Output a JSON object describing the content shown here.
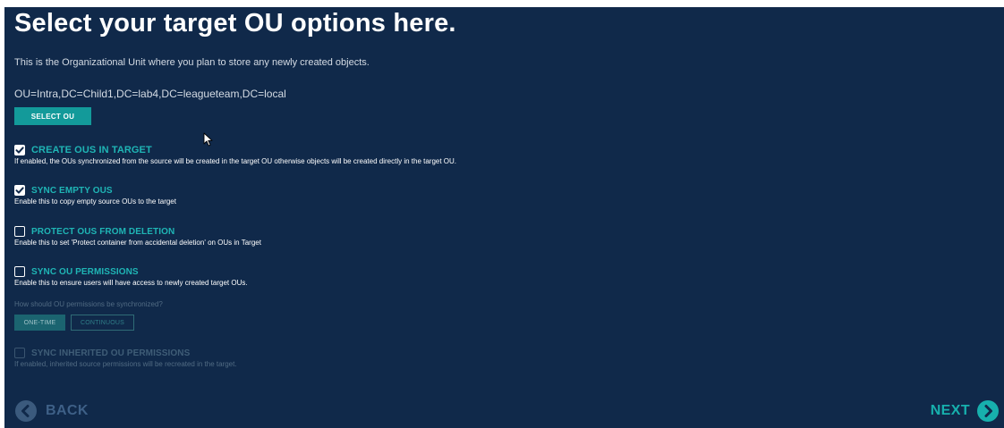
{
  "page": {
    "title": "Select your target OU options here.",
    "subtitle": "This is the Organizational Unit where you plan to store any newly created objects."
  },
  "target_ou": {
    "path": "OU=Intra,DC=Child1,DC=lab4,DC=leagueteam,DC=local",
    "select_button_label": "SELECT OU"
  },
  "options": [
    {
      "label": "CREATE OUS IN TARGET",
      "description": "If enabled, the OUs synchronized from the source will be created in the target OU otherwise objects will be created directly in the target OU.",
      "checked": true,
      "enabled": true
    },
    {
      "label": "SYNC EMPTY OUS",
      "description": "Enable this to copy empty source OUs to the target",
      "checked": true,
      "enabled": true
    },
    {
      "label": "PROTECT OUS FROM DELETION",
      "description": "Enable this to set 'Protect container from accidental deletion' on OUs in Target",
      "checked": false,
      "enabled": true
    },
    {
      "label": "SYNC OU PERMISSIONS",
      "description": "Enable this to ensure users will have access to newly created target OUs.",
      "checked": false,
      "enabled": true
    }
  ],
  "permissions_sync": {
    "question": "How should OU permissions be synchronized?",
    "modes": [
      "ONE-TIME",
      "CONTINUOUS"
    ],
    "selected_mode": "ONE-TIME"
  },
  "inherited_option": {
    "label": "SYNC INHERITED OU PERMISSIONS",
    "description": "If enabled, inherited source permissions will be recreated in the target.",
    "checked": false,
    "enabled": false
  },
  "navigation": {
    "back_label": "BACK",
    "next_label": "NEXT"
  },
  "icons": {
    "back": "chevron-left-circle-icon",
    "next": "chevron-right-circle-icon",
    "checkmark": "checkmark-icon",
    "cursor": "mouse-pointer-icon"
  },
  "colors": {
    "background": "#10294a",
    "accent": "#139a9a",
    "option_label": "#1fb5b5",
    "back_button": "#3b5a7d",
    "next_button": "#17b0ad"
  }
}
